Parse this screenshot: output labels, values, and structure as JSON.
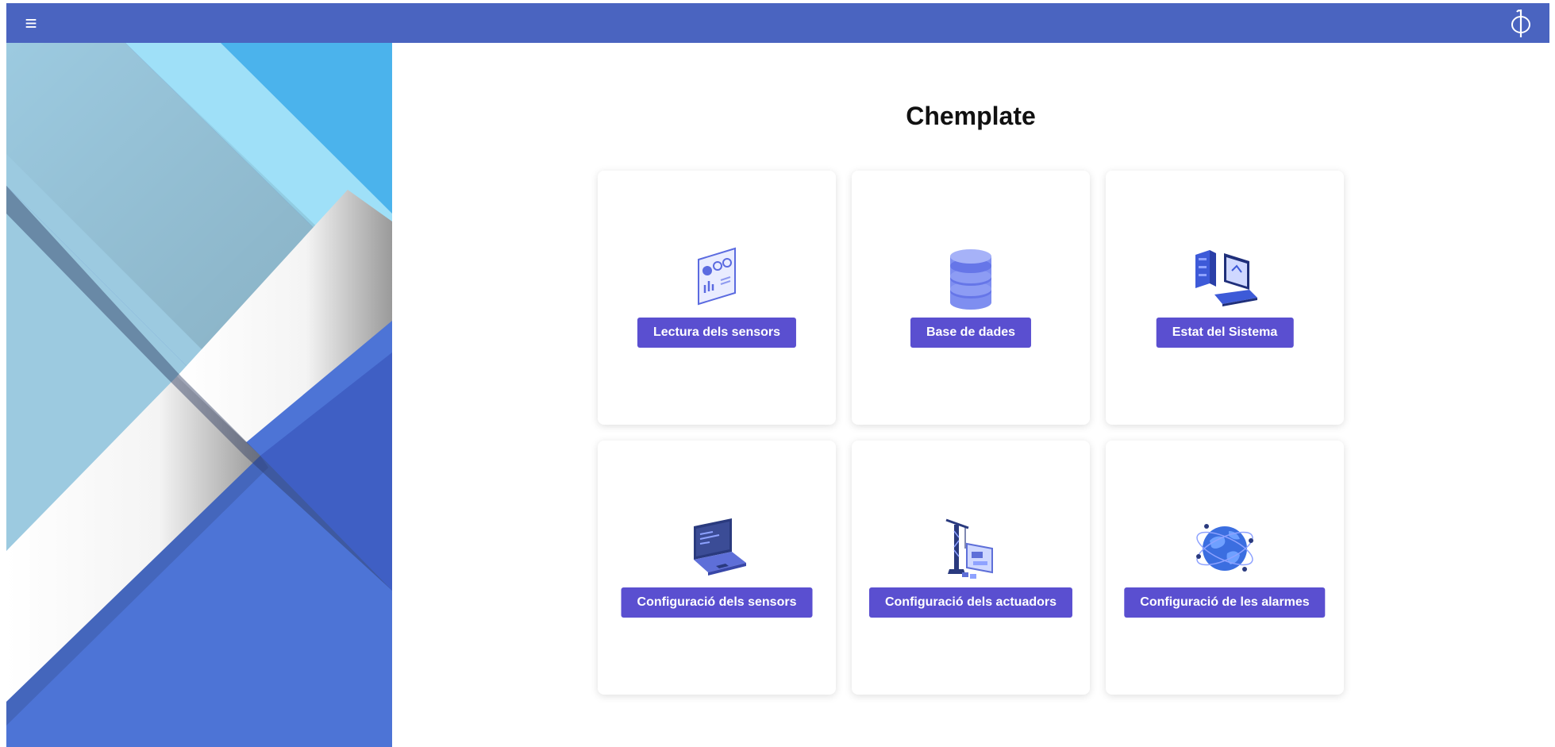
{
  "header": {
    "menu_icon": "hamburger-menu-icon",
    "menu_glyph": "≡",
    "logo_icon": "phi-logo-icon",
    "color": "#4a64c0"
  },
  "main": {
    "title": "Chemplate",
    "cards": [
      {
        "label": "Lectura dels sensors",
        "icon": "dashboard-analytics-icon"
      },
      {
        "label": "Base de dades",
        "icon": "database-icon"
      },
      {
        "label": "Estat del Sistema",
        "icon": "server-laptop-monitor-icon"
      },
      {
        "label": "Configuració dels sensors",
        "icon": "laptop-code-icon"
      },
      {
        "label": "Configuració dels actuadors",
        "icon": "crane-blueprint-icon"
      },
      {
        "label": "Configuració de les alarmes",
        "icon": "globe-network-icon"
      }
    ],
    "button_color": "#5a4fd0"
  }
}
